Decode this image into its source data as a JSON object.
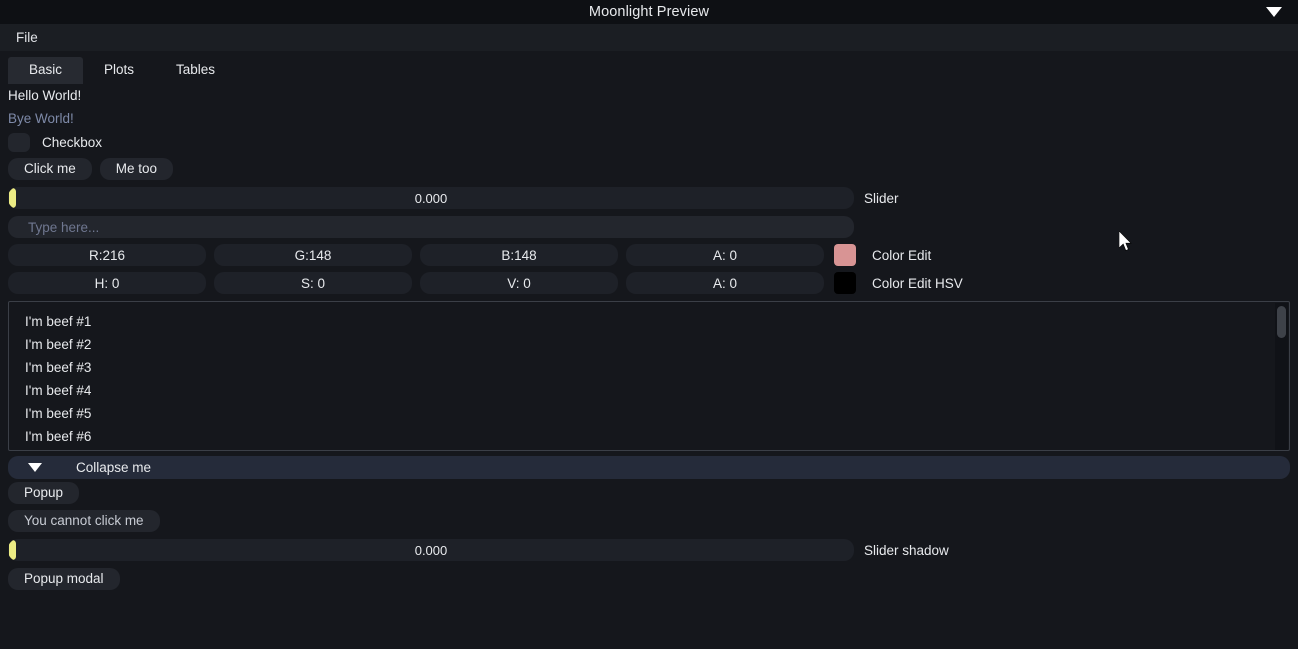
{
  "window": {
    "title": "Moonlight Preview",
    "menu_arrow_icon": "chevron-down-icon"
  },
  "menubar": {
    "items": [
      {
        "label": "File"
      }
    ]
  },
  "tabs": {
    "active": "Basic",
    "items": [
      {
        "label": "Basic"
      },
      {
        "label": "Plots"
      },
      {
        "label": "Tables"
      }
    ]
  },
  "basic": {
    "hello_text": "Hello World!",
    "bye_text": "Bye World!",
    "bye_color": "#7e8aa8",
    "checkbox": {
      "label": "Checkbox",
      "checked": false
    },
    "buttons": {
      "click_me": "Click me",
      "me_too": "Me too"
    },
    "slider": {
      "value": "0.000",
      "label": "Slider",
      "handle_color": "#ecec84",
      "fraction": 0
    },
    "text_input": {
      "value": "",
      "placeholder": "Type here..."
    },
    "color_edit": {
      "label": "Color Edit",
      "swatch_color": "#d89494",
      "fields": [
        {
          "text": "R:216"
        },
        {
          "text": "G:148"
        },
        {
          "text": "B:148"
        },
        {
          "text": "A:  0"
        }
      ]
    },
    "color_edit_hsv": {
      "label": "Color Edit HSV",
      "swatch_color": "#000000",
      "fields": [
        {
          "text": "H:  0"
        },
        {
          "text": "S:  0"
        },
        {
          "text": "V:  0"
        },
        {
          "text": "A:  0"
        }
      ]
    },
    "list": {
      "items": [
        {
          "label": "I'm beef #1"
        },
        {
          "label": "I'm beef #2"
        },
        {
          "label": "I'm beef #3"
        },
        {
          "label": "I'm beef #4"
        },
        {
          "label": "I'm beef #5"
        },
        {
          "label": "I'm beef #6"
        }
      ]
    },
    "collapse": {
      "title": "Collapse me",
      "expanded": true,
      "arrow_icon": "triangle-down-icon"
    },
    "popup_button": "Popup",
    "disabled_button": "You cannot click me",
    "slider_shadow": {
      "value": "0.000",
      "label": "Slider shadow",
      "fraction": 0
    },
    "popup_modal_button": "Popup modal"
  }
}
